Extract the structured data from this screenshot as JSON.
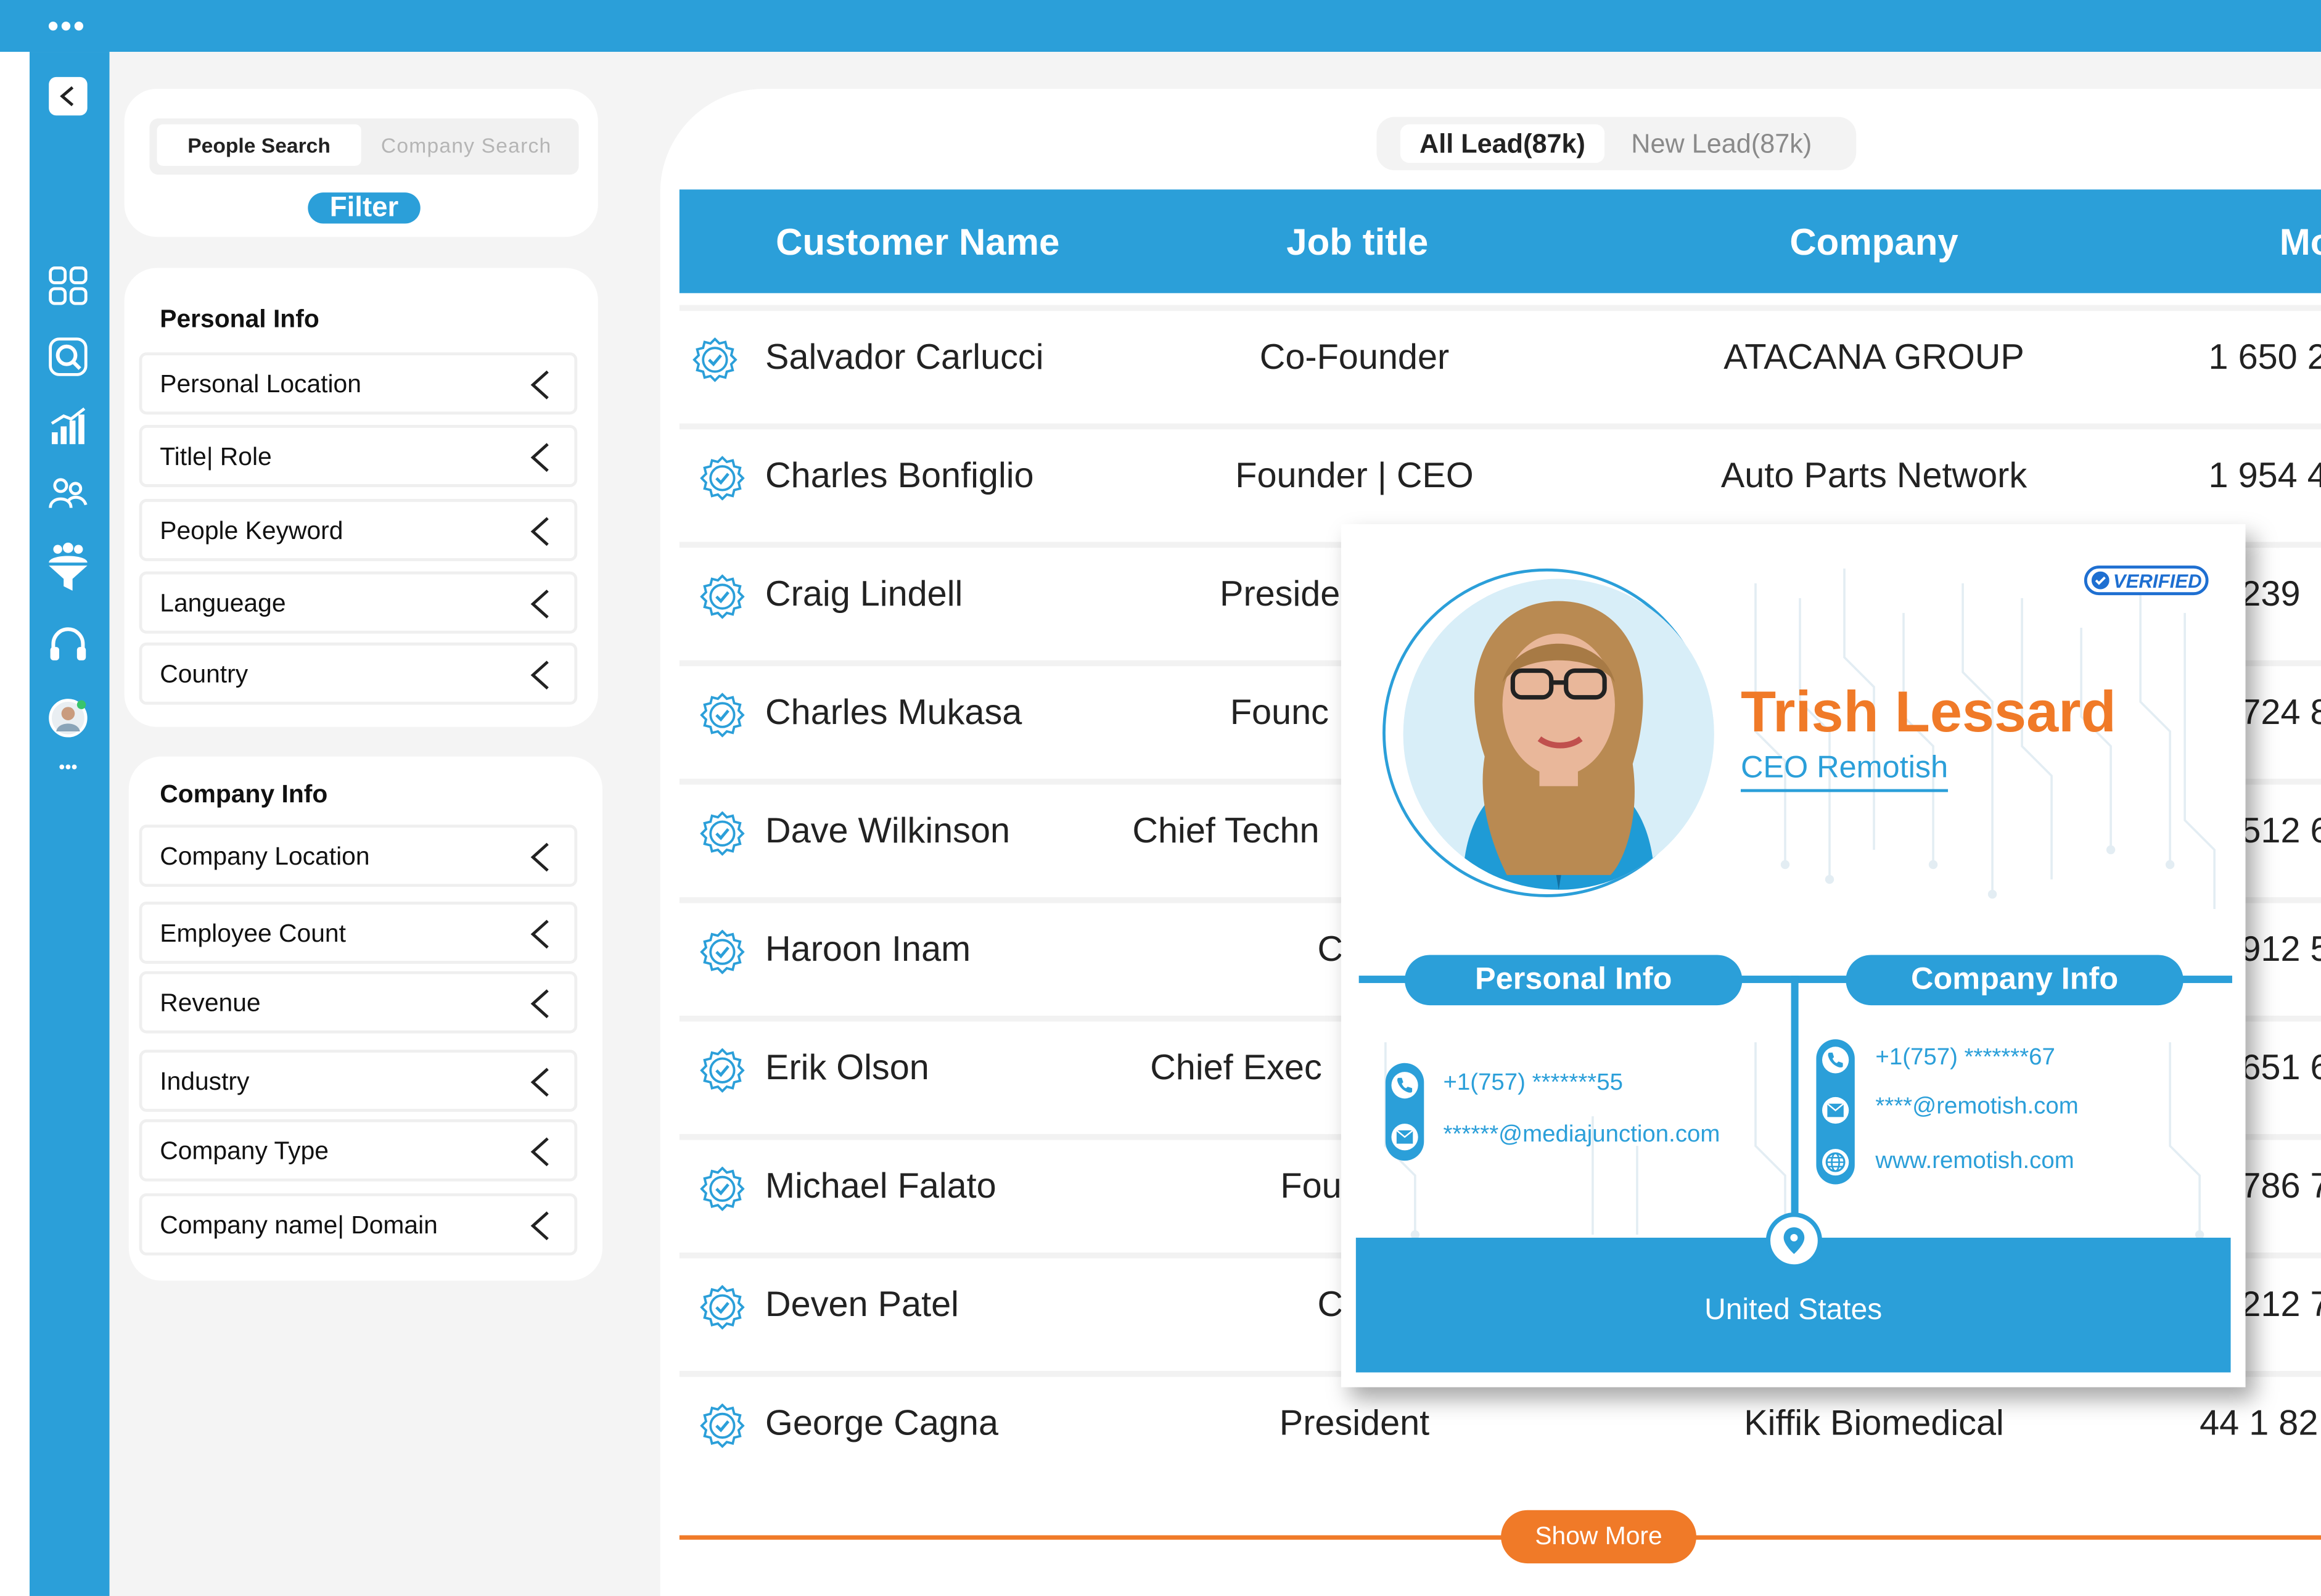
{
  "search_toggle": {
    "active": "People Search",
    "inactive": "Company Search"
  },
  "filter_label": "Filter",
  "personal_info": {
    "title": "Personal Info",
    "items": [
      "Personal Location",
      "Title| Role",
      "People Keyword",
      "Langueage",
      "Country"
    ]
  },
  "company_info": {
    "title": "Company Info",
    "items": [
      "Company Location",
      "Employee Count",
      "Revenue",
      "Industry",
      "Company Type",
      "Company name| Domain"
    ]
  },
  "tabs": {
    "all": "All Lead(87k)",
    "new": "New Lead(87k)"
  },
  "table": {
    "headers": [
      "Customer Name",
      "Job title",
      "Company",
      "Mo"
    ],
    "rows": [
      {
        "name": "Salvador Carlucci",
        "title": "Co-Founder",
        "company": "ATACANA GROUP",
        "mobile": "1 650 2"
      },
      {
        "name": "Charles Bonfiglio",
        "title": "Founder | CEO",
        "company": "Auto Parts Network",
        "mobile": "1 954 4"
      },
      {
        "name": "Craig Lindell",
        "title": "Preside",
        "company": "",
        "mobile": "239"
      },
      {
        "name": "Charles Mukasa",
        "title": "Founc",
        "company": "",
        "mobile": "724 8"
      },
      {
        "name": "Dave Wilkinson",
        "title": "Chief Techn",
        "company": "",
        "mobile": "512 6"
      },
      {
        "name": "Haroon Inam",
        "title": "C",
        "company": "",
        "mobile": "912 5"
      },
      {
        "name": "Erik Olson",
        "title": "Chief Exec",
        "company": "",
        "mobile": "651 6"
      },
      {
        "name": "Michael Falato",
        "title": "Fou",
        "company": "",
        "mobile": "786 7"
      },
      {
        "name": "Deven Patel",
        "title": "C",
        "company": "",
        "mobile": "212 7"
      },
      {
        "name": "George Cagna",
        "title": "President",
        "company": "Kiffik Biomedical",
        "mobile": "44 1 82"
      }
    ]
  },
  "show_more": "Show More",
  "profile": {
    "verified": "VERIFIED",
    "name": "Trish Lessard",
    "title": "CEO Remotish",
    "personal_info_label": "Personal Info",
    "company_info_label": "Company Info",
    "personal_phone": "+1(757) *******55",
    "personal_email": "******@mediajunction.com",
    "company_phone": "+1(757) *******67",
    "company_email": "****@remotish.com",
    "company_website": "www.remotish.com",
    "location": "United States"
  },
  "colors": {
    "accent": "#2b9fd9",
    "orange": "#f07a28",
    "verified_blue": "#1e6fd1"
  },
  "sidebar_icons": [
    "back-icon",
    "grid-icon",
    "search-icon",
    "analytics-icon",
    "team-icon",
    "funnel-icon",
    "headset-icon",
    "avatar",
    "more-icon"
  ]
}
